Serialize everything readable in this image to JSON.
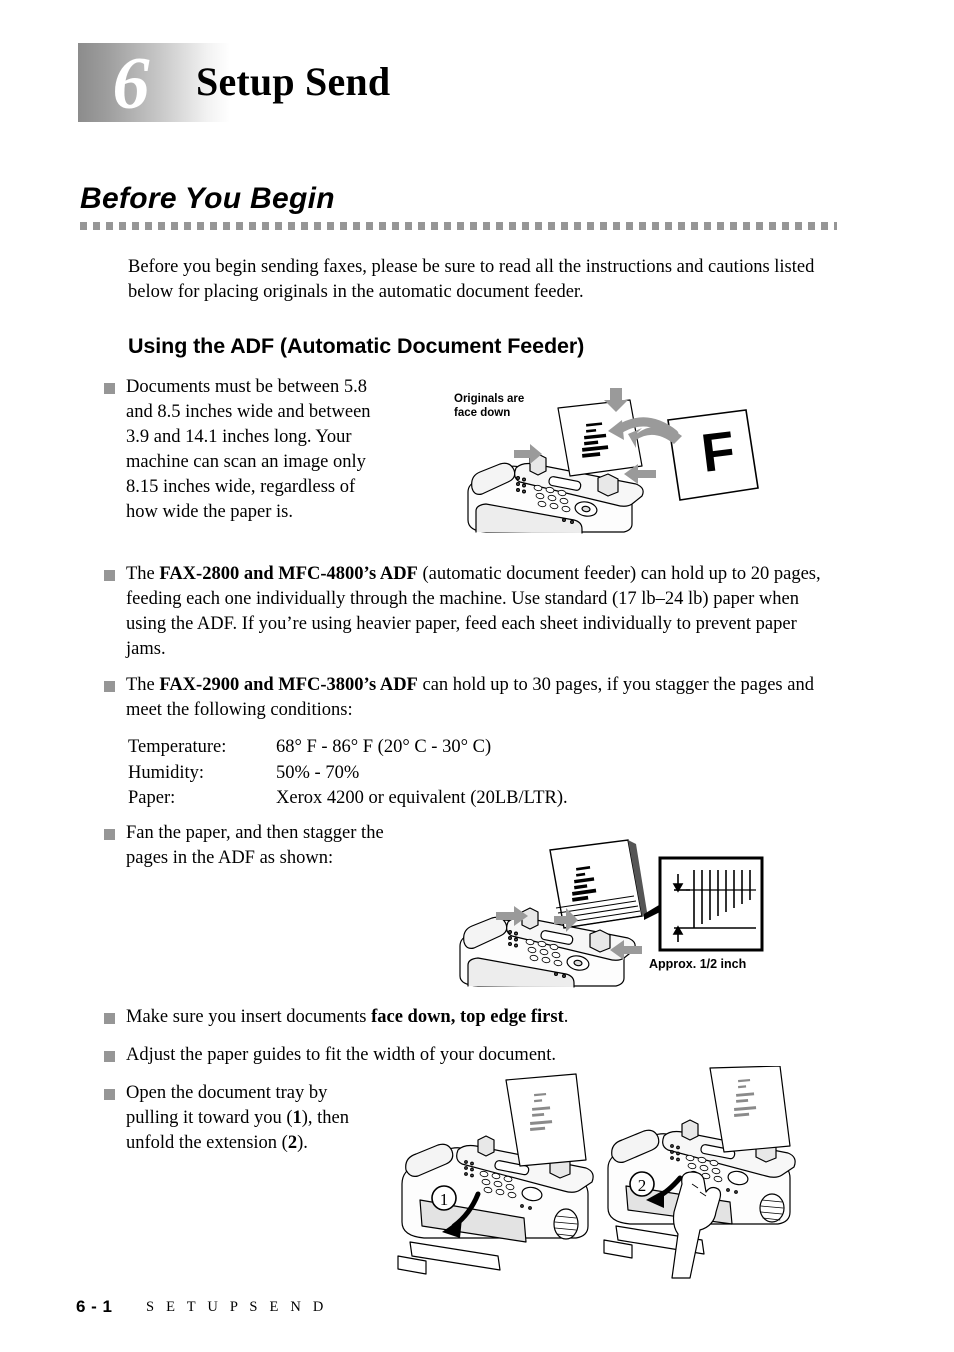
{
  "chapter": {
    "number": "6",
    "title": "Setup Send"
  },
  "section": {
    "title": "Before You Begin",
    "intro": "Before you begin sending faxes, please be sure to read all the instructions and cautions listed below for placing originals in the automatic document feeder."
  },
  "subsection": {
    "title": "Using the ADF (Automatic Document Feeder)"
  },
  "bullets": {
    "documents": {
      "text": "Documents must be between 5.8 and 8.5 inches wide and between 3.9 and 14.1 inches long. Your machine can scan an image only 8.15 inches wide, regardless of how wide the paper is."
    },
    "fax2800": {
      "lead": "The ",
      "bold": "FAX-2800 and MFC-4800’s ADF",
      "rest": " (automatic document feeder) can hold up to 20 pages, feeding each one individually through the machine. Use standard (17 lb–24 lb) paper when using the ADF. If you’re using heavier paper, feed each sheet individually to prevent paper jams."
    },
    "fax2900": {
      "lead": "The ",
      "bold": "FAX-2900 and MFC-3800’s ADF",
      "rest": " can hold up to 30 pages, if you stagger the pages and meet the following conditions:"
    },
    "fan": {
      "text": "Fan the paper, and then stagger the pages in the ADF as shown:"
    },
    "facedown": {
      "lead": "Make sure you insert documents ",
      "bold": "face down, top edge first",
      "rest": "."
    },
    "guides": {
      "text": "Adjust the paper guides to fit the width of your document."
    },
    "tray": {
      "part1": "Open the document tray by pulling it toward you (",
      "num1": "1",
      "part2": "), then unfold the extension (",
      "num2": "2",
      "part3": ")."
    }
  },
  "conditions": [
    {
      "label": "Temperature:",
      "value": "68° F - 86° F (20° C - 30° C)"
    },
    {
      "label": "Humidity:",
      "value": "50% - 70%"
    },
    {
      "label": "Paper:",
      "value": "Xerox 4200 or equivalent (20LB/LTR)."
    }
  ],
  "figures": {
    "facedown_label": "Originals are\nface down",
    "facedown_page_letter": "F",
    "stagger_label": "Approx. 1/2 inch",
    "tray_step1": "1",
    "tray_step2": "2"
  },
  "footer": {
    "page": "6 - 1",
    "title": "S E T U P   S E N D"
  },
  "colors": {
    "bullet_gray": "#969696",
    "rule_gray": "#969696",
    "header_gradient_start": "#8c8c8c",
    "header_gradient_end": "#ffffff"
  }
}
